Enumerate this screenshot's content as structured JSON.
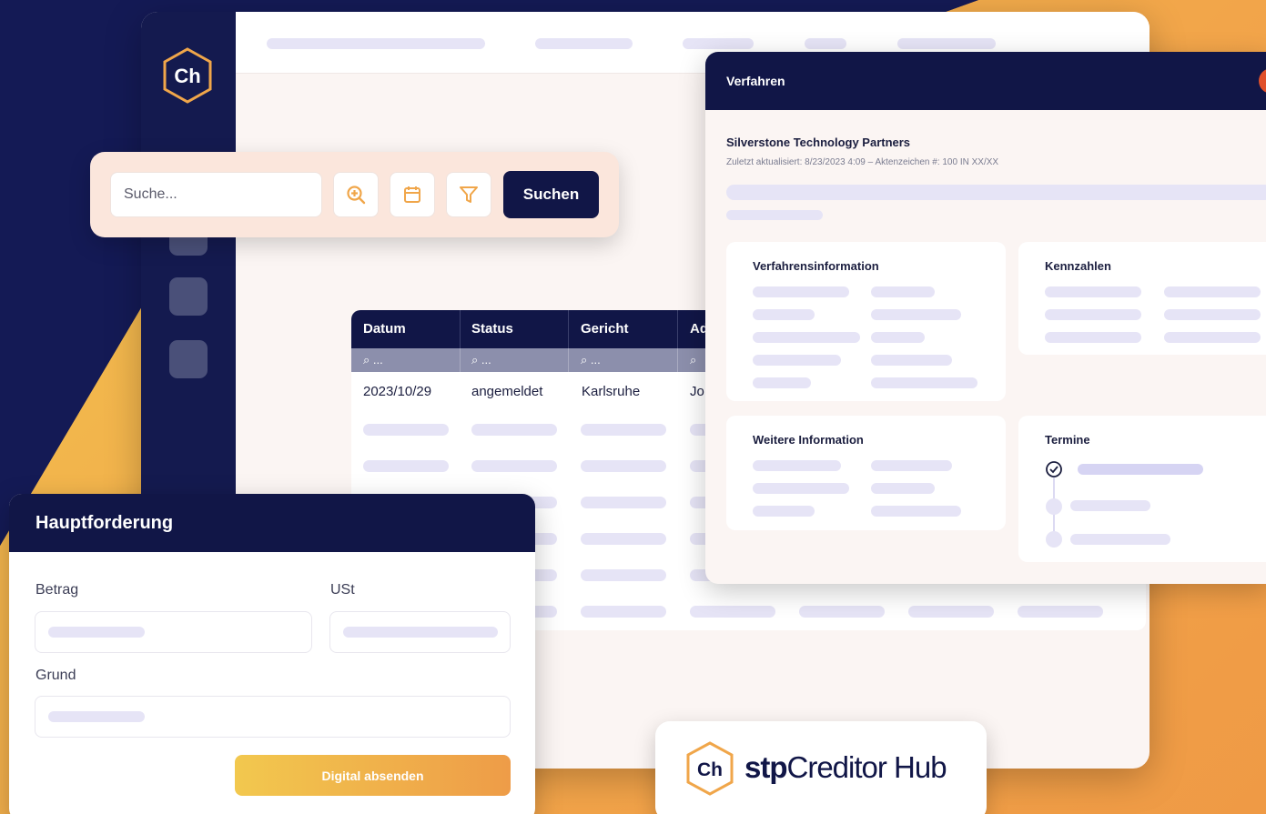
{
  "colors": {
    "navy": "#111647",
    "accent_orange": "#f0a64a",
    "accent_yellow": "#f2c84e",
    "pill": "#e6e4f6"
  },
  "sidebar": {
    "logo_text": "Ch"
  },
  "search": {
    "placeholder": "Suche...",
    "icons": [
      "zoom-in-icon",
      "calendar-icon",
      "filter-icon"
    ],
    "button_label": "Suchen"
  },
  "table": {
    "columns": [
      "Datum",
      "Status",
      "Gericht",
      "Ad"
    ],
    "filter_placeholder": "...",
    "rows": [
      {
        "datum": "2023/10/29",
        "status": "angemeldet",
        "gericht": "Karlsruhe",
        "ad": "Jo"
      }
    ]
  },
  "verfahren": {
    "title": "Verfahren",
    "company": "Silverstone Technology Partners",
    "meta": "Zuletzt aktualisiert: 8/23/2023 4:09 – Aktenzeichen #: 100 IN XX/XX",
    "cards": {
      "info": "Verfahrensinformation",
      "kennzahlen": "Kennzahlen",
      "weitere": "Weitere Information",
      "termine": "Termine"
    }
  },
  "haupt": {
    "title": "Hauptforderung",
    "betrag_label": "Betrag",
    "ust_label": "USt",
    "grund_label": "Grund",
    "submit_label": "Digital absenden"
  },
  "brand": {
    "logo_text": "Ch",
    "stp": "stp",
    "name": "Creditor Hub"
  }
}
